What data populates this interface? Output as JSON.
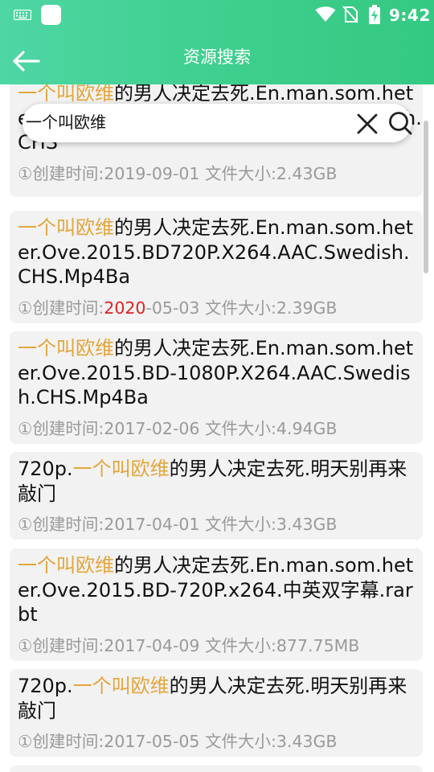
{
  "status_bar": {
    "time": "9:42",
    "icons": [
      "keyboard-icon",
      "notification-icon",
      "wifi-icon",
      "no-sim-icon",
      "battery-charging-icon"
    ]
  },
  "header": {
    "title": "资源搜索",
    "back_icon": "arrow-left-icon"
  },
  "search": {
    "query": "一个叫欧维",
    "clear_icon": "close-icon",
    "search_icon": "search-icon"
  },
  "colors": {
    "header": "#3fcf8e",
    "highlight": "#e3a63a",
    "date_highlight": "#e02020",
    "card_bg": "#f2f2f2",
    "meta_text": "#9a9a9a"
  },
  "results": [
    {
      "title_prefix": "",
      "title_highlight": "一个叫欧维",
      "title_rest": "的男人决定去死.En.man.som.heter.Ove.2015.BD1080P.X264.AAC.Swedish.CHS",
      "created_label": "①创建时间:",
      "date_year": "2019",
      "date_rest": "-09-01",
      "size_label": "文件大小:",
      "size": "2.43GB"
    },
    {
      "title_prefix": "",
      "title_highlight": "一个叫欧维",
      "title_rest": "的男人决定去死.En.man.som.heter.Ove.2015.BD720P.X264.AAC.Swedish.CHS.Mp4Ba",
      "created_label": "①创建时间:",
      "date_year": "2020",
      "date_rest": "-05-03",
      "size_label": "文件大小:",
      "size": "2.39GB"
    },
    {
      "title_prefix": "",
      "title_highlight": "一个叫欧维",
      "title_rest": "的男人决定去死.En.man.som.heter.Ove.2015.BD-1080P.X264.AAC.Swedish.CHS.Mp4Ba",
      "created_label": "①创建时间:",
      "date_year": "2017",
      "date_rest": "-02-06",
      "size_label": "文件大小:",
      "size": "4.94GB"
    },
    {
      "title_prefix": "720p.",
      "title_highlight": "一个叫欧维",
      "title_rest": "的男人决定去死.明天别再来敲门",
      "created_label": "①创建时间:",
      "date_year": "2017",
      "date_rest": "-04-01",
      "size_label": "文件大小:",
      "size": "3.43GB"
    },
    {
      "title_prefix": "",
      "title_highlight": "一个叫欧维",
      "title_rest": "的男人决定去死.En.man.som.heter.Ove.2015.BD-720P.x264.中英双字幕.rarbt",
      "created_label": "①创建时间:",
      "date_year": "2017",
      "date_rest": "-04-09",
      "size_label": "文件大小:",
      "size": "877.75MB"
    },
    {
      "title_prefix": "720p.",
      "title_highlight": "一个叫欧维",
      "title_rest": "的男人决定去死.明天别再来敲门",
      "created_label": "①创建时间:",
      "date_year": "2017",
      "date_rest": "-05-05",
      "size_label": "文件大小:",
      "size": "3.43GB"
    }
  ]
}
